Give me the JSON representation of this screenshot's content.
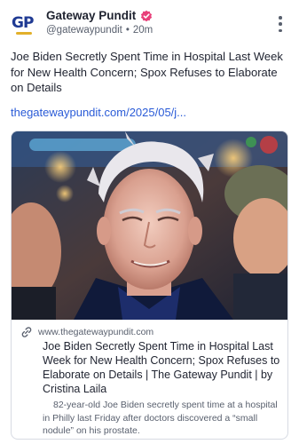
{
  "account": {
    "avatar_text": "GP",
    "display_name": "Gateway Pundit",
    "handle": "@gatewaypundit",
    "separator": "•",
    "timestamp": "20m",
    "verified_icon": "verified-badge-icon",
    "verified_color": "#e8407a"
  },
  "post": {
    "text": "Joe Biden Secretly Spent Time in Hospital Last Week for New Health Concern; Spox Refuses to Elaborate on Details",
    "link_text": "thegatewaypundit.com/2025/05/j..."
  },
  "link_card": {
    "domain": "www.thegatewaypundit.com",
    "title": "Joe Biden Secretly Spent Time in Hospital Last Week for New Health Concern; Spox Refuses to Elaborate on Details | The Gateway Pundit | by Cristina Laila",
    "description": "82-year-old Joe Biden secretly spent time at a hospital in Philly last Friday after doctors discovered a “small nodule” on his prostate."
  },
  "colors": {
    "accent_link": "#2a5bd7",
    "brand_blue": "#1f3a93",
    "brand_gold": "#e2b02a"
  }
}
